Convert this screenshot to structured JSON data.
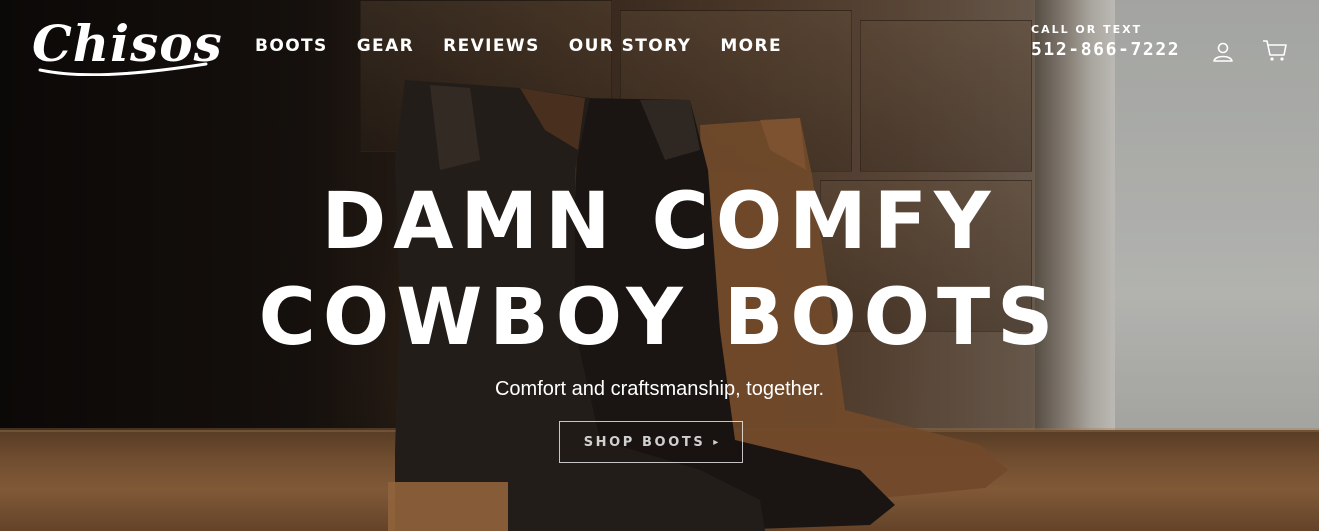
{
  "brand": {
    "logo_text": "Chisos"
  },
  "nav": {
    "items": [
      {
        "label": "BOOTS"
      },
      {
        "label": "GEAR"
      },
      {
        "label": "REVIEWS"
      },
      {
        "label": "OUR STORY"
      },
      {
        "label": "MORE"
      }
    ]
  },
  "contact": {
    "label": "CALL OR TEXT",
    "phone": "512-866-7222"
  },
  "header_icons": {
    "account": "user-icon",
    "cart": "cart-icon"
  },
  "hero": {
    "headline_line1": "DAMN COMFY",
    "headline_line2": "COWBOY BOOTS",
    "subheadline": "Comfort and craftsmanship, together.",
    "cta_label": "SHOP BOOTS",
    "cta_arrow": "▸"
  },
  "colors": {
    "text": "#ffffff",
    "boot_dark": "#2a2420",
    "boot_tan": "#8b5a34",
    "shelf": "#9d6d44"
  }
}
